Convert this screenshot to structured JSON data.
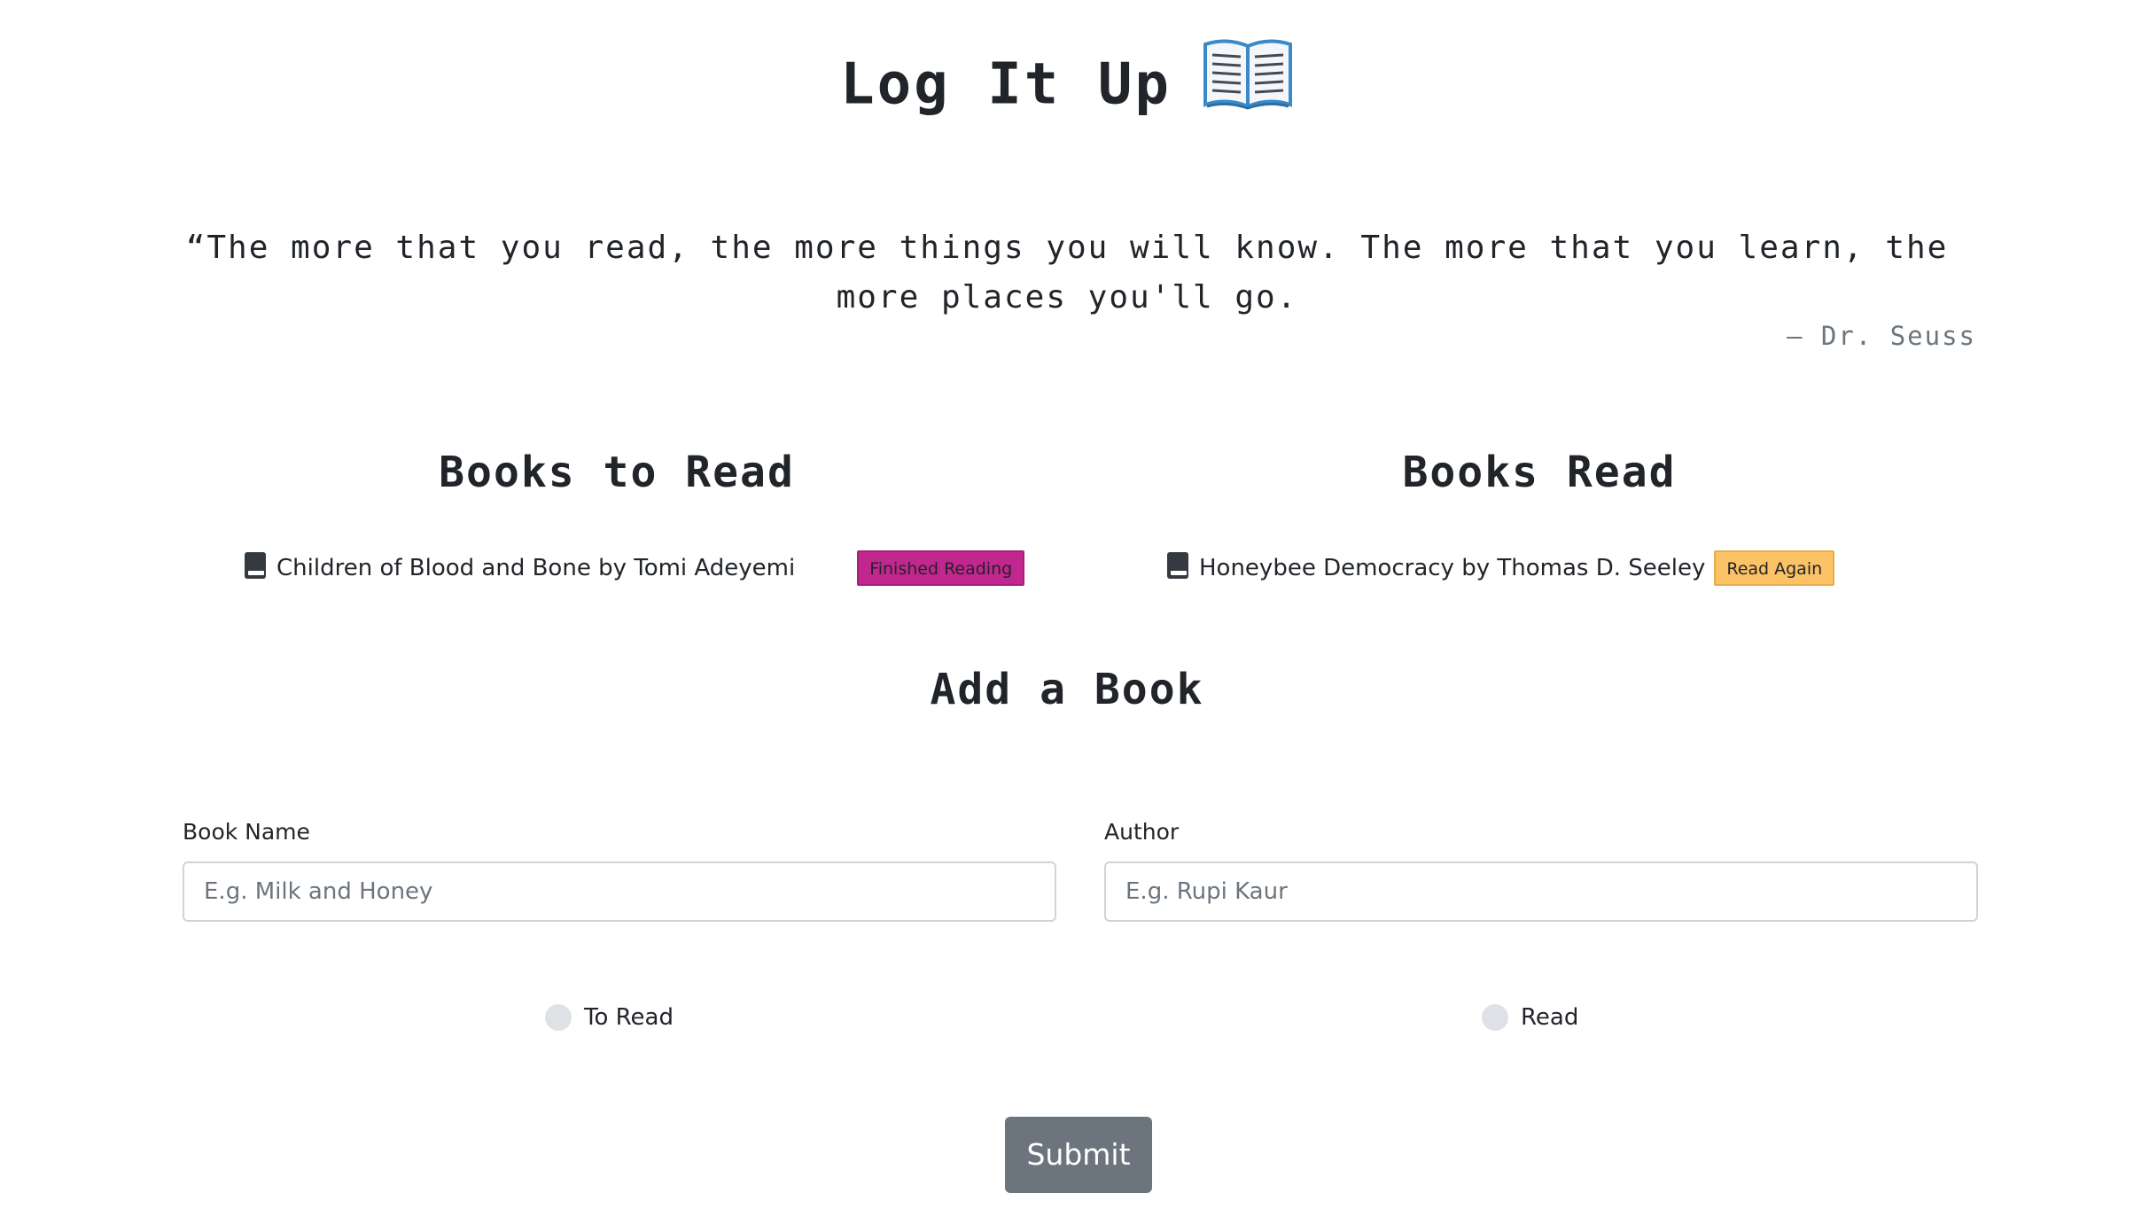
{
  "header": {
    "title": "Log It Up",
    "title_icon": "open-book-icon"
  },
  "quote": {
    "text": "“The more that you read, the more things you will know. The more that you learn, the more places you'll go.",
    "author": "— Dr. Seuss"
  },
  "to_read": {
    "heading": "Books to Read",
    "books": [
      {
        "text": "Children of Blood and Bone by Tomi Adeyemi",
        "icon": "book-icon",
        "action_label": "Finished Reading",
        "action_color": "#c2268f"
      }
    ]
  },
  "read": {
    "heading": "Books Read",
    "books": [
      {
        "text": "Honeybee Democracy by Thomas D. Seeley",
        "icon": "book-icon",
        "action_label": "Read Again",
        "action_color": "#fbc266"
      }
    ]
  },
  "add_book": {
    "heading": "Add a Book",
    "book_name_label": "Book Name",
    "book_name_value": "",
    "book_name_placeholder": "E.g. Milk and Honey",
    "author_label": "Author",
    "author_value": "",
    "author_placeholder": "E.g. Rupi Kaur",
    "radio_to_read_label": "To Read",
    "radio_read_label": "Read",
    "submit_label": "Submit",
    "submit_color": "#6c757d"
  }
}
